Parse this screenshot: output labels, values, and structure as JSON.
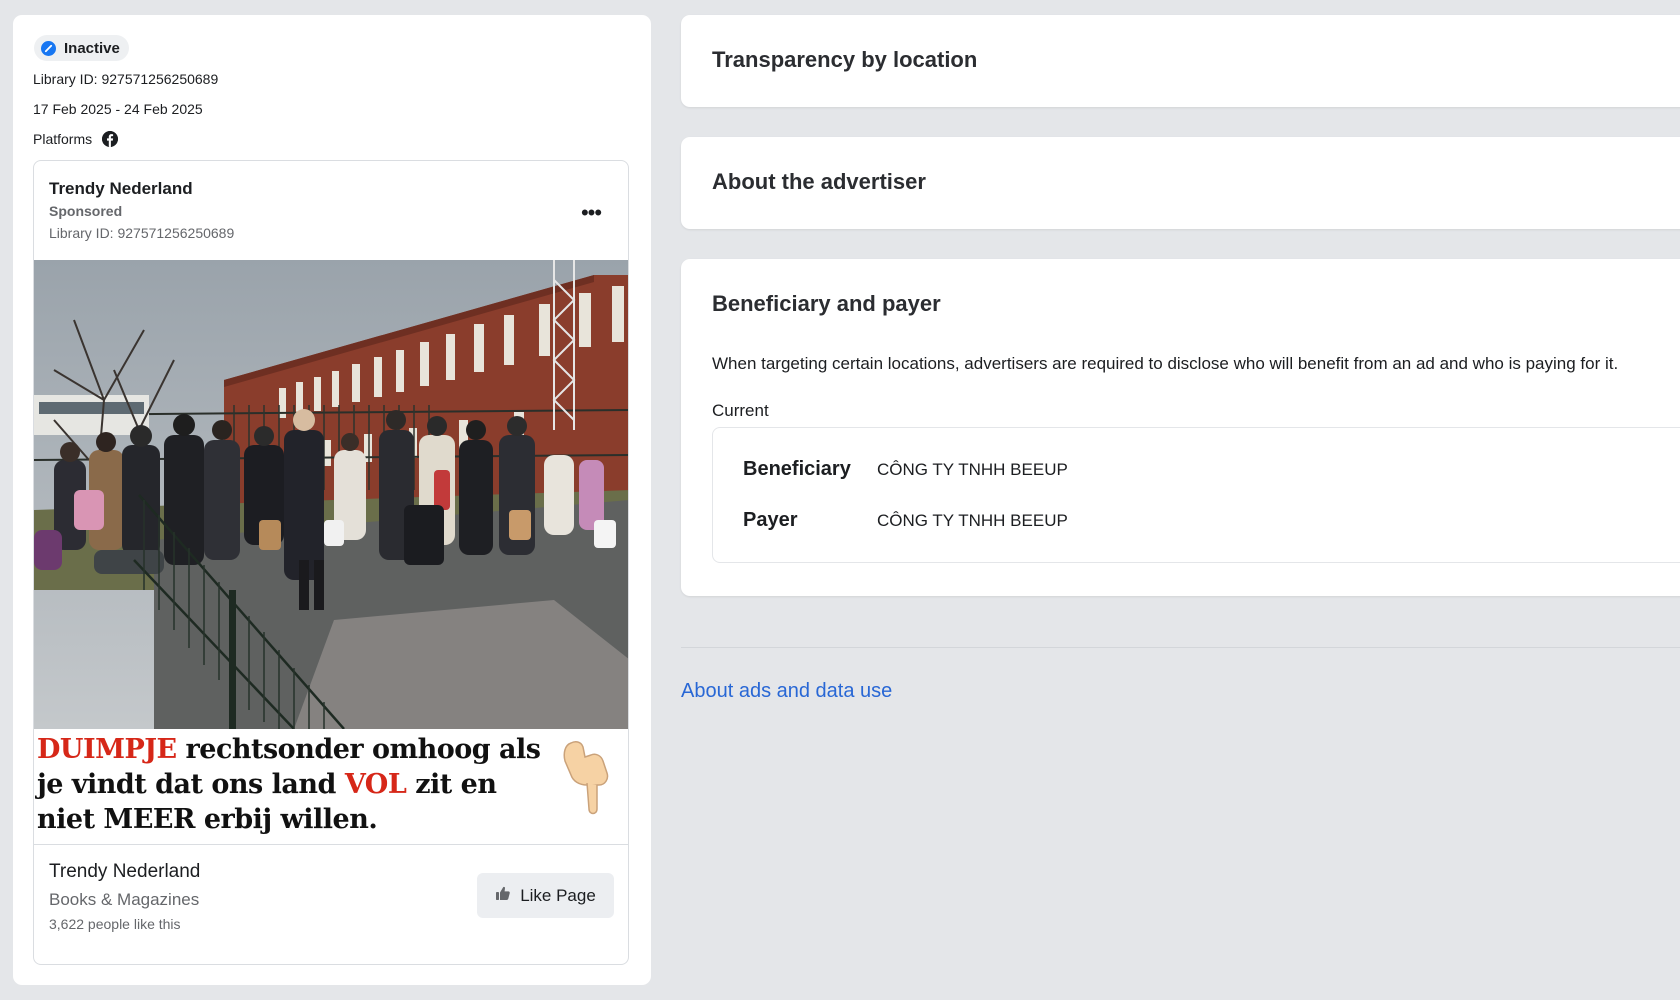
{
  "ad": {
    "status": "Inactive",
    "library_id_line": "Library ID: 927571256250689",
    "date_range": "17 Feb 2025 - 24 Feb 2025",
    "platforms_label": "Platforms",
    "platform_icons": [
      "facebook-icon"
    ],
    "preview": {
      "advertiser": "Trendy Nederland",
      "sponsored": "Sponsored",
      "library_id_line": "Library ID: 927571256250689",
      "more_label": "•••",
      "caption": {
        "part1_red": "DUIMPJE",
        "part2": " rechtsonder omhoog als je vindt dat ons land ",
        "part3_red": "VOL",
        "part4": " zit en niet MEER erbij willen."
      },
      "footer": {
        "page_name": "Trendy Nederland",
        "category": "Books & Magazines",
        "likes": "3,622 people like this",
        "like_button": "Like Page"
      }
    }
  },
  "sections": {
    "transparency_title": "Transparency by location",
    "advertiser_title": "About the advertiser",
    "beneficiary": {
      "title": "Beneficiary and payer",
      "description": "When targeting certain locations, advertisers are required to disclose who will benefit from an ad and who is paying for it.",
      "current_label": "Current",
      "rows": [
        {
          "key": "Beneficiary",
          "value": "CÔNG TY TNHH BEEUP"
        },
        {
          "key": "Payer",
          "value": "CÔNG TY TNHH BEEUP"
        }
      ]
    }
  },
  "footer_link": "About ads and data use",
  "colors": {
    "page_bg": "#e4e6e9",
    "status_blue": "#1877f2",
    "link_blue": "#2867d5",
    "caption_red": "#d62718"
  }
}
